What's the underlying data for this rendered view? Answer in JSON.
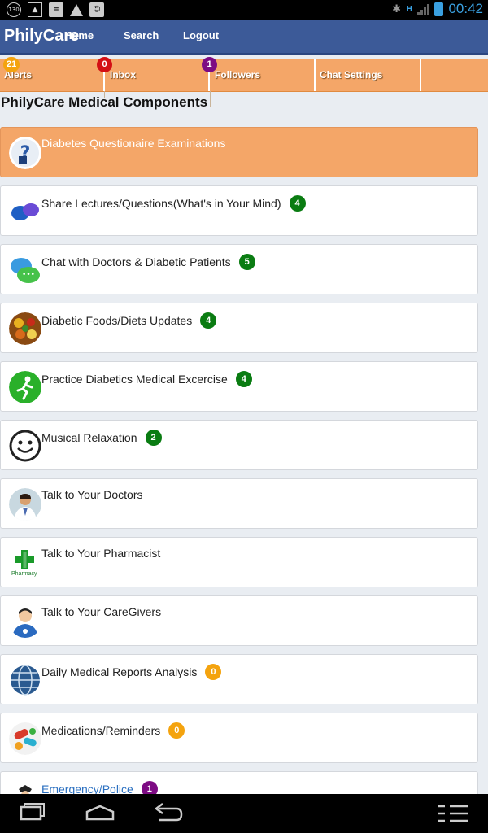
{
  "status_bar": {
    "notification_count": "130",
    "clock": "00:42",
    "network_type": "H",
    "icons": [
      "counter-icon",
      "image-icon",
      "message-icon",
      "warning-icon",
      "bbm-icon",
      "bluetooth-icon",
      "signal-icon",
      "battery-icon"
    ]
  },
  "header": {
    "app_title": "PhilyCare",
    "nav": [
      {
        "label": "Home"
      },
      {
        "label": "Search"
      },
      {
        "label": "Logout"
      }
    ]
  },
  "tabs": [
    {
      "label": "Alerts",
      "badge": "21",
      "badge_color": "#f4a30e"
    },
    {
      "label": "Inbox",
      "badge": "0",
      "badge_color": "#d40f14"
    },
    {
      "label": "Followers",
      "badge": "1",
      "badge_color": "#7d0b83"
    },
    {
      "label": "Chat Settings",
      "badge": null
    }
  ],
  "section_title": "PhilyCare Medical Components",
  "items": [
    {
      "label": "Diabetes Questionaire Examinations",
      "count": null,
      "icon": "doctor-question-icon",
      "active": true
    },
    {
      "label": "Share Lectures/Questions(What's in Your Mind)",
      "count": "4",
      "count_color": "#0a7c12",
      "icon": "chat-bubbles-icon"
    },
    {
      "label": "Chat with Doctors & Diabetic Patients",
      "count": "5",
      "count_color": "#0a7c12",
      "icon": "speech-bubbles-icon"
    },
    {
      "label": "Diabetic Foods/Diets Updates",
      "count": "4",
      "count_color": "#0a7c12",
      "icon": "food-icon"
    },
    {
      "label": "Practice Diabetics Medical Excercise",
      "count": "4",
      "count_color": "#0a7c12",
      "icon": "running-man-icon"
    },
    {
      "label": "Musical Relaxation",
      "count": "2",
      "count_color": "#0a7c12",
      "icon": "smiley-icon"
    },
    {
      "label": "Talk to Your Doctors",
      "count": null,
      "icon": "doctor-photo-icon"
    },
    {
      "label": "Talk to Your Pharmacist",
      "count": null,
      "icon": "pharmacy-cross-icon",
      "icon_text": "Pharmacy"
    },
    {
      "label": "Talk to Your CareGivers",
      "count": null,
      "icon": "caregiver-icon"
    },
    {
      "label": "Daily Medical Reports Analysis",
      "count": "0",
      "count_color": "#f4a30e",
      "icon": "globe-icon"
    },
    {
      "label": "Medications/Reminders",
      "count": "0",
      "count_color": "#f4a30e",
      "icon": "pills-icon"
    },
    {
      "label": "Emergency/Police",
      "count": "1",
      "count_color": "#7d0b83",
      "icon": "police-icon"
    }
  ],
  "colors": {
    "header_bg": "#3c5a98",
    "tabs_bg": "#f4a668",
    "active_item_bg": "#f4a668",
    "link": "#2a6fc0"
  },
  "system_nav": [
    "back-icon",
    "home-icon",
    "recent-apps-icon",
    "menu-icon"
  ]
}
